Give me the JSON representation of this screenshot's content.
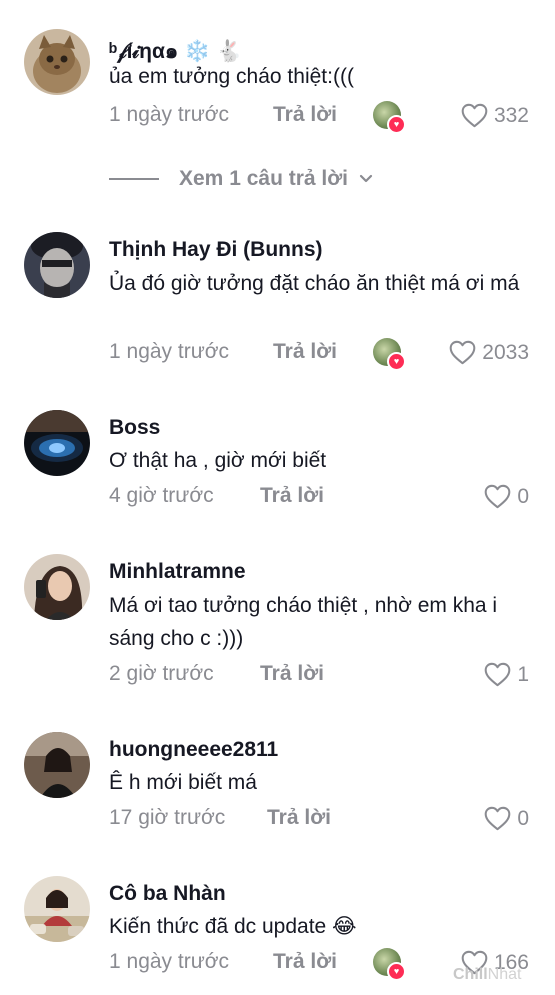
{
  "reply_label": "Trả lời",
  "view_replies_label": "Xem 1 câu trả lời",
  "comments": [
    {
      "username": "ᵇ𝒻í𝒾ηα๑ ❄️ 🐇",
      "text": "ủa em tưởng cháo thiệt:(((",
      "time": "1 ngày trước",
      "likes": "332",
      "creator_liked": true
    },
    {
      "username": "Thịnh Hay Đi (Bunns)",
      "text": "Ủa đó giờ tưởng đặt cháo ăn thiệt má ơi má",
      "time": "1 ngày trước",
      "likes": "2033",
      "creator_liked": true
    },
    {
      "username": "Boss",
      "text": "Ơ thật ha , giờ mới biết",
      "time": "4 giờ trước",
      "likes": "0",
      "creator_liked": false
    },
    {
      "username": "Minhlatramne",
      "text": "Má ơi tao tưởng cháo thiệt , nhờ em kha i sáng cho c :)))",
      "time": "2 giờ trước",
      "likes": "1",
      "creator_liked": false
    },
    {
      "username": "huongneeee2811",
      "text": "Ê h mới biết má",
      "time": "17 giờ trước",
      "likes": "0",
      "creator_liked": false
    },
    {
      "username": "Cô ba Nhàn",
      "text": "Kiến thức đã dc update 😂",
      "time": "1 ngày trước",
      "likes": "166",
      "creator_liked": true
    }
  ],
  "watermark": {
    "part1": "Chill",
    "part2": "Nhat"
  }
}
